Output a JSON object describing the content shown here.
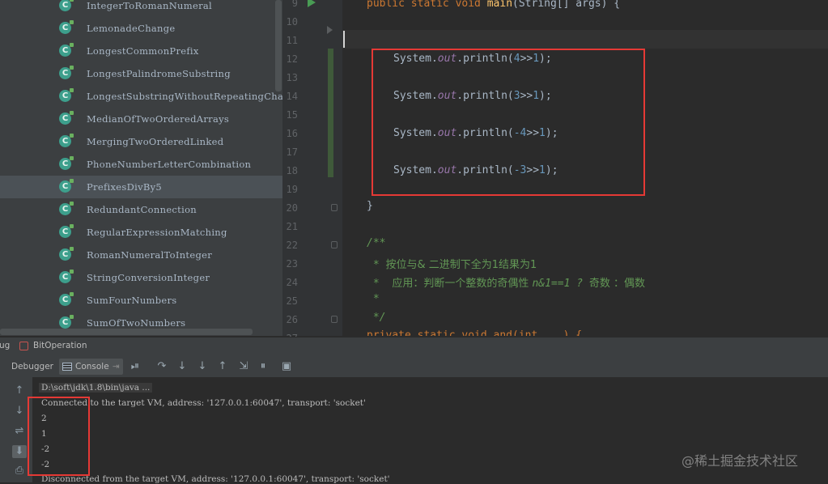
{
  "project_tree": {
    "items": [
      {
        "label": "IntegerToRomanNumeral"
      },
      {
        "label": "LemonadeChange"
      },
      {
        "label": "LongestCommonPrefix"
      },
      {
        "label": "LongestPalindromeSubstring"
      },
      {
        "label": "LongestSubstringWithoutRepeatingCha"
      },
      {
        "label": "MedianOfTwoOrderedArrays"
      },
      {
        "label": "MergingTwoOrderedLinked"
      },
      {
        "label": "PhoneNumberLetterCombination"
      },
      {
        "label": "PrefixesDivBy5",
        "selected": true
      },
      {
        "label": "RedundantConnection"
      },
      {
        "label": "RegularExpressionMatching"
      },
      {
        "label": "RomanNumeralToInteger"
      },
      {
        "label": "StringConversionInteger"
      },
      {
        "label": "SumFourNumbers"
      },
      {
        "label": "SumOfTwoNumbers"
      }
    ],
    "class_icon_letter": "C"
  },
  "editor": {
    "line_numbers": [
      "9",
      "10",
      "11",
      "12",
      "13",
      "14",
      "15",
      "16",
      "17",
      "18",
      "19",
      "20",
      "21",
      "22",
      "23",
      "24",
      "25",
      "26",
      "27"
    ],
    "main_kw": "public static void ",
    "main_name": "main",
    "main_rest": "(String[] args) {",
    "stmt_prefix": "System.",
    "stmt_out": "out",
    "stmt_call": ".println(",
    "stmts": [
      {
        "arg": "4",
        "op": ">>",
        "rhs": "1",
        "end": ");"
      },
      {
        "arg": "3",
        "op": ">>",
        "rhs": "1",
        "end": ");"
      },
      {
        "arg": "-4",
        "op": ">>",
        "rhs": "1",
        "end": ");"
      },
      {
        "arg": "-3",
        "op": ">>",
        "rhs": "1",
        "end": ");"
      }
    ],
    "close_brace": "}",
    "doc_open": "/**",
    "doc_line1_prefix": " * ",
    "doc_line1_text": "按位与& 二进制下全为1结果为1",
    "doc_line2_prefix": " *  ",
    "doc_line2_text": "应用：判断一个整数的奇偶性 ",
    "doc_line2_expr": "n&1==1 ? ",
    "doc_line2_text2": "奇数 ：偶数",
    "doc_line3": " *",
    "doc_close": " */",
    "last_line": "private static void and(int ...) {"
  },
  "debug": {
    "tool_label": "ug",
    "config_name": "BitOperation",
    "tabs": {
      "debugger": "Debugger",
      "console": "Console"
    },
    "console_lines": {
      "command": "D:\\soft\\jdk\\1.8\\bin\\java ...",
      "connected": "Connected to the target VM, address: '127.0.0.1:60047', transport: 'socket'",
      "outputs": [
        "2",
        "1",
        "-2",
        "-2"
      ],
      "disconnected": "Disconnected from the target VM, address: '127.0.0.1:60047', transport: 'socket'"
    }
  },
  "watermark": "@稀土掘金技术社区"
}
